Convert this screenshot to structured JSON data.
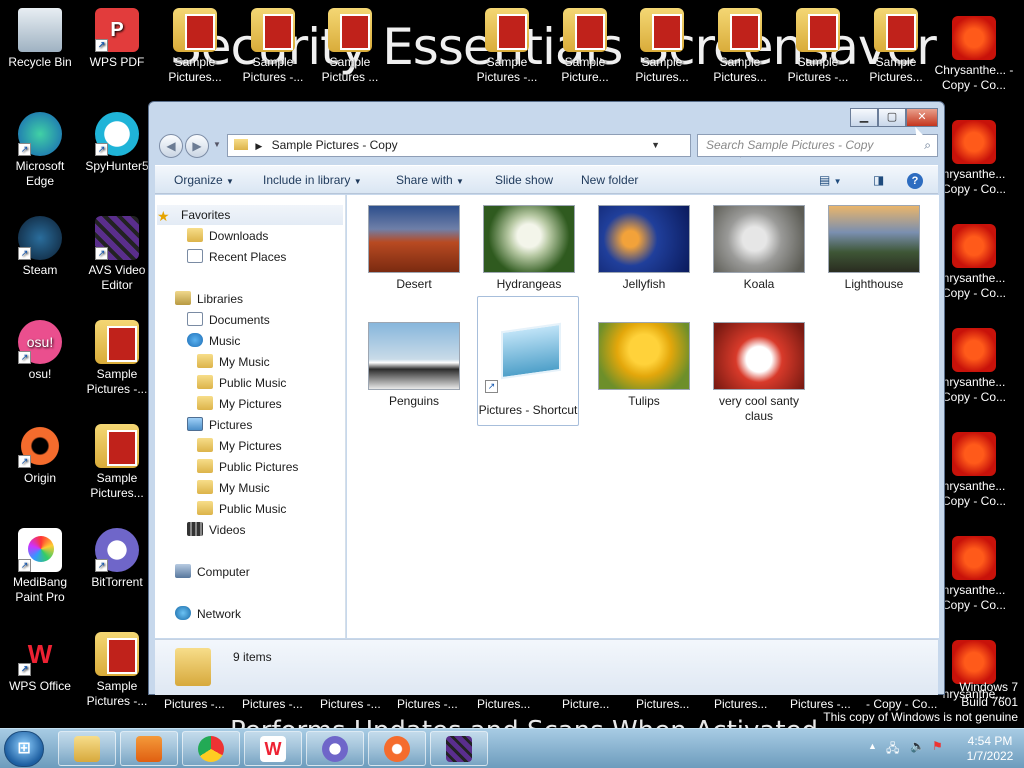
{
  "screensaver": {
    "top_text": "Security Essentials Screensaver",
    "bottom_text": "Performs Updates and Scans When Activated"
  },
  "desktop": {
    "left_col1": [
      {
        "name": "recycle-bin",
        "label": "Recycle Bin"
      },
      {
        "name": "microsoft-edge",
        "label": "Microsoft Edge"
      },
      {
        "name": "steam",
        "label": "Steam"
      },
      {
        "name": "osu",
        "label": "osu!"
      },
      {
        "name": "origin",
        "label": "Origin"
      },
      {
        "name": "medibang",
        "label": "MediBang Paint Pro"
      },
      {
        "name": "wps-office",
        "label": "WPS Office"
      }
    ],
    "left_col2": [
      {
        "name": "wps-pdf",
        "label": "WPS PDF"
      },
      {
        "name": "spyhunter",
        "label": "SpyHunter5"
      },
      {
        "name": "avs-video-editor",
        "label": "AVS Video Editor"
      },
      {
        "name": "sample-pictures-1",
        "label": "Sample Pictures -..."
      },
      {
        "name": "sample-pictures-2",
        "label": "Sample Pictures..."
      },
      {
        "name": "bittorrent",
        "label": "BitTorrent"
      },
      {
        "name": "sample-pictures-3",
        "label": "Sample Pictures -..."
      }
    ],
    "top_row": [
      {
        "label": "Sample Pictures..."
      },
      {
        "label": "Sample Pictures -..."
      },
      {
        "label": "Sample Pictures ..."
      },
      {
        "label": "Sample Pictures -..."
      },
      {
        "label": "Sample Picture..."
      },
      {
        "label": "Sample Pictures..."
      },
      {
        "label": "Sample Pictures..."
      },
      {
        "label": "Sample Pictures -..."
      },
      {
        "label": "Sample Pictures..."
      }
    ],
    "bottom_row": [
      "Pictures -...",
      "Pictures -...",
      "Pictures -...",
      "Pictures -...",
      "Pictures...",
      "Picture...",
      "Pictures...",
      "Pictures...",
      "Pictures -...",
      "- Copy - Co...",
      "- Copy - Co..."
    ],
    "right_col": [
      {
        "label": "Chrysanthe... - Copy - Co..."
      },
      {
        "label": "hrysanthe... Copy - Co..."
      },
      {
        "label": "hrysanthe... Copy - Co..."
      },
      {
        "label": "hrysanthe... Copy - Co..."
      },
      {
        "label": "hrysanthe... Copy - Co..."
      },
      {
        "label": "hrysanthe... Copy - Co..."
      },
      {
        "label": "hrysanthe..."
      }
    ]
  },
  "window": {
    "address": "Sample Pictures - Copy",
    "search_placeholder": "Search Sample Pictures - Copy",
    "toolbar": {
      "organize": "Organize",
      "include": "Include in library",
      "share": "Share with",
      "slideshow": "Slide show",
      "newfolder": "New folder"
    },
    "nav": {
      "favorites": "Favorites",
      "downloads": "Downloads",
      "recent": "Recent Places",
      "libraries": "Libraries",
      "documents": "Documents",
      "music": "Music",
      "my_music": "My Music",
      "public_music": "Public Music",
      "my_pictures": "My Pictures",
      "pictures": "Pictures",
      "pic_my_pictures": "My Pictures",
      "pic_public_pictures": "Public Pictures",
      "pic_my_music": "My Music",
      "pic_public_music": "Public Music",
      "videos": "Videos",
      "computer": "Computer",
      "network": "Network"
    },
    "files": [
      {
        "name": "Desert"
      },
      {
        "name": "Hydrangeas"
      },
      {
        "name": "Jellyfish"
      },
      {
        "name": "Koala"
      },
      {
        "name": "Lighthouse"
      },
      {
        "name": "Penguins"
      },
      {
        "name": "Pictures - Shortcut"
      },
      {
        "name": "Tulips"
      },
      {
        "name": "very cool santy claus"
      }
    ],
    "status": "9 items"
  },
  "taskbar": {
    "time": "4:54 PM",
    "date": "1/7/2022"
  },
  "watermark": {
    "line1": "Windows 7",
    "line2": "Build 7601",
    "line3": "This copy of Windows is not genuine"
  }
}
